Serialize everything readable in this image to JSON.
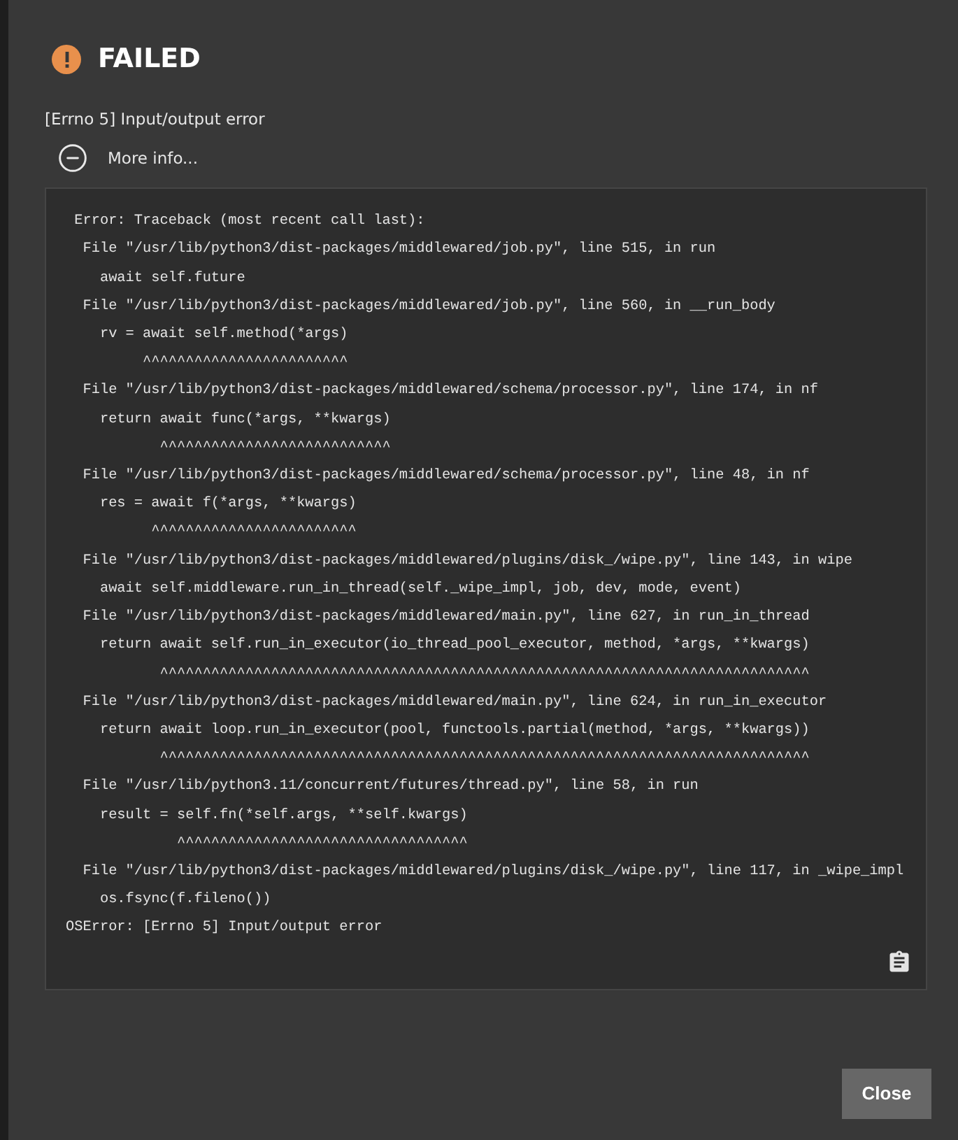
{
  "dialog": {
    "title": "FAILED",
    "message": "[Errno 5] Input/output error",
    "more_info": {
      "label": "More info...",
      "expanded": true
    },
    "traceback": [
      " Error: Traceback (most recent call last):",
      "  File \"/usr/lib/python3/dist-packages/middlewared/job.py\", line 515, in run",
      "    await self.future",
      "  File \"/usr/lib/python3/dist-packages/middlewared/job.py\", line 560, in __run_body",
      "    rv = await self.method(*args)",
      "         ^^^^^^^^^^^^^^^^^^^^^^^^",
      "  File \"/usr/lib/python3/dist-packages/middlewared/schema/processor.py\", line 174, in nf",
      "    return await func(*args, **kwargs)",
      "           ^^^^^^^^^^^^^^^^^^^^^^^^^^^",
      "  File \"/usr/lib/python3/dist-packages/middlewared/schema/processor.py\", line 48, in nf",
      "    res = await f(*args, **kwargs)",
      "          ^^^^^^^^^^^^^^^^^^^^^^^^",
      "  File \"/usr/lib/python3/dist-packages/middlewared/plugins/disk_/wipe.py\", line 143, in wipe",
      "    await self.middleware.run_in_thread(self._wipe_impl, job, dev, mode, event)",
      "  File \"/usr/lib/python3/dist-packages/middlewared/main.py\", line 627, in run_in_thread",
      "    return await self.run_in_executor(io_thread_pool_executor, method, *args, **kwargs)",
      "           ^^^^^^^^^^^^^^^^^^^^^^^^^^^^^^^^^^^^^^^^^^^^^^^^^^^^^^^^^^^^^^^^^^^^^^^^^^^^",
      "  File \"/usr/lib/python3/dist-packages/middlewared/main.py\", line 624, in run_in_executor",
      "    return await loop.run_in_executor(pool, functools.partial(method, *args, **kwargs))",
      "           ^^^^^^^^^^^^^^^^^^^^^^^^^^^^^^^^^^^^^^^^^^^^^^^^^^^^^^^^^^^^^^^^^^^^^^^^^^^^",
      "  File \"/usr/lib/python3.11/concurrent/futures/thread.py\", line 58, in run",
      "    result = self.fn(*self.args, **self.kwargs)",
      "             ^^^^^^^^^^^^^^^^^^^^^^^^^^^^^^^^^^",
      "  File \"/usr/lib/python3/dist-packages/middlewared/plugins/disk_/wipe.py\", line 117, in _wipe_impl",
      "    os.fsync(f.fileno())",
      "OSError: [Errno 5] Input/output error"
    ],
    "buttons": [
      {
        "label": "Close"
      }
    ]
  }
}
